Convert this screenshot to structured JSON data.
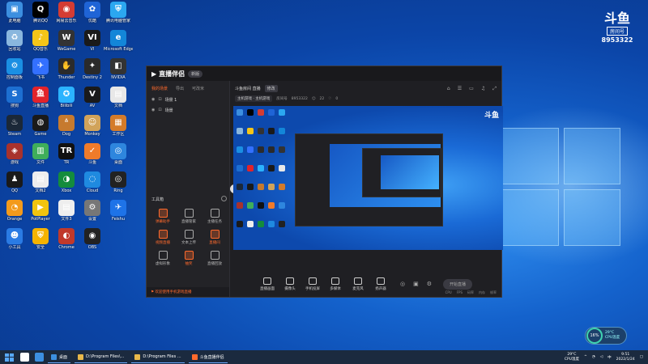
{
  "desktop": {
    "icons": [
      {
        "label": "此电脑",
        "color": "#3c8fe0",
        "glyph": "▣"
      },
      {
        "label": "腾讯QQ",
        "color": "#000000",
        "glyph": "Q"
      },
      {
        "label": "网易云音乐",
        "color": "#d43c33",
        "glyph": "◉"
      },
      {
        "label": "优酷",
        "color": "#1f64d6",
        "glyph": "✿"
      },
      {
        "label": "腾讯电脑管家",
        "color": "#2ba7f0",
        "glyph": "⛨"
      },
      {
        "label": "回收站",
        "color": "#8ab7de",
        "glyph": "♻"
      },
      {
        "label": "QQ音乐",
        "color": "#f5c518",
        "glyph": "♪"
      },
      {
        "label": "WeGame",
        "color": "#333333",
        "glyph": "W"
      },
      {
        "label": "VI",
        "color": "#1a1a1a",
        "glyph": "VI"
      },
      {
        "label": "Microsoft Edge",
        "color": "#1386d8",
        "glyph": "e"
      },
      {
        "label": "控制面板",
        "color": "#1a8fe3",
        "glyph": "⚙"
      },
      {
        "label": "飞书",
        "color": "#3370ff",
        "glyph": "✈"
      },
      {
        "label": "Thunder",
        "color": "#2b2b2b",
        "glyph": "✋"
      },
      {
        "label": "Destiny 2",
        "color": "#2a2a2a",
        "glyph": "✦"
      },
      {
        "label": "NVIDIA",
        "color": "#333333",
        "glyph": "◧"
      },
      {
        "label": "搜狗",
        "color": "#1d6fd1",
        "glyph": "S"
      },
      {
        "label": "斗鱼直播",
        "color": "#e2232a",
        "glyph": "鱼"
      },
      {
        "label": "Bilibili",
        "color": "#2bb3ff",
        "glyph": "✪"
      },
      {
        "label": "AV",
        "color": "#1a1a1a",
        "glyph": "V"
      },
      {
        "label": "文档",
        "color": "#e8e8e8",
        "glyph": "▤"
      },
      {
        "label": "Steam",
        "color": "#1b2838",
        "glyph": "♨"
      },
      {
        "label": "Game",
        "color": "#1a1a1a",
        "glyph": "◍"
      },
      {
        "label": "Dog",
        "color": "#c67a2e",
        "glyph": "ᐞ"
      },
      {
        "label": "Monkey",
        "color": "#d1a35a",
        "glyph": "☺"
      },
      {
        "label": "工作区",
        "color": "#d47b2a",
        "glyph": "▦"
      },
      {
        "label": "游戏",
        "color": "#a8322c",
        "glyph": "◈"
      },
      {
        "label": "文件",
        "color": "#3fae5a",
        "glyph": "▥"
      },
      {
        "label": "TR",
        "color": "#111111",
        "glyph": "TR"
      },
      {
        "label": "斗鱼",
        "color": "#f07b2a",
        "glyph": "✓"
      },
      {
        "label": "桌面",
        "color": "#2e86de",
        "glyph": "◎"
      },
      {
        "label": "QQ",
        "color": "#1a1a1a",
        "glyph": "♟"
      },
      {
        "label": "文档2",
        "color": "#eeeeee",
        "glyph": "▤"
      },
      {
        "label": "Xbox",
        "color": "#148c3c",
        "glyph": "◑"
      },
      {
        "label": "Cloud",
        "color": "#1f8ae0",
        "glyph": "◌"
      },
      {
        "label": "Ring",
        "color": "#222222",
        "glyph": "◎"
      },
      {
        "label": "Orange",
        "color": "#f39a1c",
        "glyph": "◔"
      },
      {
        "label": "PotPlayer",
        "color": "#f1c40f",
        "glyph": "▶"
      },
      {
        "label": "文件3",
        "color": "#eeeeee",
        "glyph": "▤"
      },
      {
        "label": "设置",
        "color": "#777777",
        "glyph": "⚙"
      },
      {
        "label": "Feishu",
        "color": "#1e73e8",
        "glyph": "✈"
      },
      {
        "label": "小工具",
        "color": "#2a7be4",
        "glyph": "☻"
      },
      {
        "label": "安全",
        "color": "#f5b300",
        "glyph": "⛨"
      },
      {
        "label": "Chrome",
        "color": "#c0392b",
        "glyph": "◐"
      },
      {
        "label": "OBS",
        "color": "#222222",
        "glyph": "◉"
      }
    ]
  },
  "room_badge": {
    "logo": "斗鱼",
    "tag": "房间号",
    "number": "8953322"
  },
  "app": {
    "brand": "直播伴侣",
    "version": "新版",
    "tabs": [
      "我的场景",
      "导出",
      "可改米"
    ],
    "scenes": [
      {
        "label": "场景 1"
      },
      {
        "label": "场景"
      }
    ],
    "tools_title": "工具箱",
    "tools": [
      {
        "label": "弹幕助手",
        "hot": true
      },
      {
        "label": "直播管家",
        "hot": false
      },
      {
        "label": "主播任务",
        "hot": false
      },
      {
        "label": "视频直播",
        "hot": true
      },
      {
        "label": "文本上传",
        "hot": false
      },
      {
        "label": "直播间",
        "hot": true
      },
      {
        "label": "虚拟形象",
        "hot": false
      },
      {
        "label": "抽奖",
        "hot": true
      },
      {
        "label": "直播回放",
        "hot": false
      }
    ],
    "left_footer": "欢迎使用手机游戏直播",
    "room_title": "斗鱼房间 直播",
    "room_chip": "修改",
    "room_category": "主机游戏 · 主机游戏",
    "room_id_label": "房间号",
    "room_id": "8953322",
    "room_count": "22",
    "room_count2": "0",
    "preview_logo": "斗鱼",
    "controls": [
      {
        "label": "直播画面"
      },
      {
        "label": "摄像头"
      },
      {
        "label": "手机投屏"
      },
      {
        "label": "多媒体"
      },
      {
        "label": "麦克风"
      },
      {
        "label": "扬声器"
      }
    ],
    "start_label": "开始直播",
    "stats": [
      "CPU",
      "FPS",
      "码率",
      "内存",
      "帧率"
    ]
  },
  "perf": {
    "percent": "16%",
    "temp": "29°C",
    "label": "CPU温度"
  },
  "taskbar": {
    "items": [
      {
        "label": "桌面",
        "color": "#3c8fe0"
      },
      {
        "label": "D:\\Program Files\\...",
        "color": "#e8b84a"
      },
      {
        "label": "D:\\Program Files ...",
        "color": "#e8b84a"
      },
      {
        "label": "斗鱼直播伴侣",
        "color": "#ff6a2c"
      }
    ],
    "weather_temp": "29°C",
    "weather_label": "CPU温度",
    "time": "9:51",
    "date": "2022/1/24"
  }
}
